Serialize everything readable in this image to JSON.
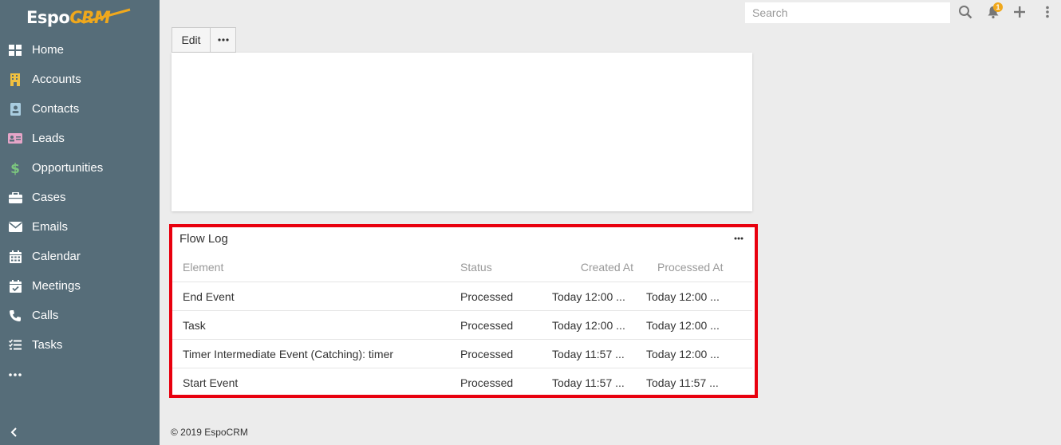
{
  "app": {
    "logo_main": "Espo",
    "logo_accent": "CRM"
  },
  "sidebar": {
    "items": [
      {
        "label": "Home",
        "icon": "home-grid-icon"
      },
      {
        "label": "Accounts",
        "icon": "building-icon"
      },
      {
        "label": "Contacts",
        "icon": "contact-card-icon"
      },
      {
        "label": "Leads",
        "icon": "id-card-icon"
      },
      {
        "label": "Opportunities",
        "icon": "dollar-icon"
      },
      {
        "label": "Cases",
        "icon": "briefcase-icon"
      },
      {
        "label": "Emails",
        "icon": "envelope-icon"
      },
      {
        "label": "Calendar",
        "icon": "calendar-icon"
      },
      {
        "label": "Meetings",
        "icon": "calendar-check-icon"
      },
      {
        "label": "Calls",
        "icon": "phone-icon"
      },
      {
        "label": "Tasks",
        "icon": "tasks-icon"
      }
    ],
    "more_icon": "ellipsis-icon",
    "collapse_icon": "chevron-left-icon"
  },
  "topbar": {
    "search_placeholder": "Search",
    "notification_count": "1"
  },
  "toolbar": {
    "edit_label": "Edit",
    "more_label": "•••"
  },
  "flow_log": {
    "title": "Flow Log",
    "columns": {
      "element": "Element",
      "status": "Status",
      "created_at": "Created At",
      "processed_at": "Processed At"
    },
    "rows": [
      {
        "element": "End Event",
        "status": "Processed",
        "created_at": "Today 12:00 ...",
        "processed_at": "Today 12:00 ..."
      },
      {
        "element": "Task",
        "status": "Processed",
        "created_at": "Today 12:00 ...",
        "processed_at": "Today 12:00 ..."
      },
      {
        "element": "Timer Intermediate Event (Catching): timer",
        "status": "Processed",
        "created_at": "Today 11:57 ...",
        "processed_at": "Today 12:00 ..."
      },
      {
        "element": "Start Event",
        "status": "Processed",
        "created_at": "Today 11:57 ...",
        "processed_at": "Today 11:57 ..."
      }
    ]
  },
  "footer": {
    "text": "© 2019 EspoCRM"
  },
  "colors": {
    "sidebar_bg": "#566d79",
    "accent": "#f0a81c",
    "highlight": "#e8000e",
    "page_bg": "#ececec"
  }
}
